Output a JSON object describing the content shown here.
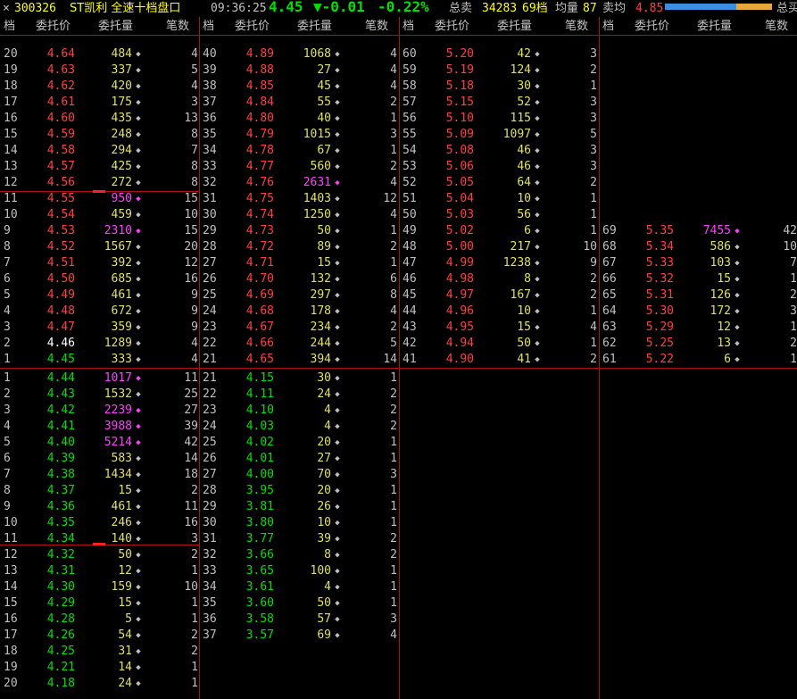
{
  "header": {
    "close": "×",
    "code": "300326",
    "name": "ST凯利 全速十档盘口",
    "time": "09:36:25",
    "price": "4.45",
    "change": "▼-0.01",
    "pct": "-0.22%",
    "total_sell_label": "总卖",
    "total_sell": "34283",
    "levels": "69档",
    "avg_label": "均量",
    "avg_val": "87",
    "sell_avg_label": "卖均",
    "sell_avg": "4.85",
    "total_label_right": "总买"
  },
  "colors": {
    "bg": "#000000",
    "grid": "#b01010",
    "sell": "#ff4040",
    "buy": "#00e000",
    "vol": "#e0e060",
    "highlight": "#ff40ff"
  },
  "columns": [
    "档",
    "委托价",
    "委托量",
    "笔数"
  ],
  "sell_cols": [
    {
      "rows": [
        {
          "i": "20",
          "p": "4.64",
          "v": "484",
          "d": "◆",
          "c": "4"
        },
        {
          "i": "19",
          "p": "4.63",
          "v": "337",
          "d": "◆",
          "c": "5"
        },
        {
          "i": "18",
          "p": "4.62",
          "v": "420",
          "d": "◆",
          "c": "4"
        },
        {
          "i": "17",
          "p": "4.61",
          "v": "175",
          "d": "◆",
          "c": "3"
        },
        {
          "i": "16",
          "p": "4.60",
          "v": "435",
          "d": "◆",
          "c": "13"
        },
        {
          "i": "15",
          "p": "4.59",
          "v": "248",
          "d": "◆",
          "c": "8"
        },
        {
          "i": "14",
          "p": "4.58",
          "v": "294",
          "d": "◆",
          "c": "7"
        },
        {
          "i": "13",
          "p": "4.57",
          "v": "425",
          "d": "◆",
          "c": "8"
        },
        {
          "i": "12",
          "p": "4.56",
          "v": "272",
          "d": "◆",
          "c": "8"
        },
        {
          "i": "11",
          "p": "4.55",
          "v": "950",
          "d": "◆",
          "c": "15",
          "m": true
        },
        {
          "i": "10",
          "p": "4.54",
          "v": "459",
          "d": "◆",
          "c": "10"
        },
        {
          "i": "9",
          "p": "4.53",
          "v": "2310",
          "d": "◆",
          "c": "15",
          "m": true
        },
        {
          "i": "8",
          "p": "4.52",
          "v": "1567",
          "d": "◆",
          "c": "20"
        },
        {
          "i": "7",
          "p": "4.51",
          "v": "392",
          "d": "◆",
          "c": "12"
        },
        {
          "i": "6",
          "p": "4.50",
          "v": "685",
          "d": "◆",
          "c": "16"
        },
        {
          "i": "5",
          "p": "4.49",
          "v": "461",
          "d": "◆",
          "c": "9"
        },
        {
          "i": "4",
          "p": "4.48",
          "v": "672",
          "d": "◆",
          "c": "9"
        },
        {
          "i": "3",
          "p": "4.47",
          "v": "359",
          "d": "◆",
          "c": "9"
        },
        {
          "i": "2",
          "p": "4.46",
          "v": "1289",
          "d": "◆",
          "c": "4",
          "w": true
        },
        {
          "i": "1",
          "p": "4.45",
          "v": "333",
          "d": "◆",
          "c": "4",
          "g": true
        }
      ]
    },
    {
      "rows": [
        {
          "i": "40",
          "p": "4.89",
          "v": "1068",
          "d": "◆",
          "c": "4"
        },
        {
          "i": "39",
          "p": "4.88",
          "v": "27",
          "d": "◆",
          "c": "4"
        },
        {
          "i": "38",
          "p": "4.85",
          "v": "45",
          "d": "◆",
          "c": "4"
        },
        {
          "i": "37",
          "p": "4.84",
          "v": "55",
          "d": "◆",
          "c": "2"
        },
        {
          "i": "36",
          "p": "4.80",
          "v": "40",
          "d": "◆",
          "c": "1"
        },
        {
          "i": "35",
          "p": "4.79",
          "v": "1015",
          "d": "◆",
          "c": "3"
        },
        {
          "i": "34",
          "p": "4.78",
          "v": "67",
          "d": "◆",
          "c": "1"
        },
        {
          "i": "33",
          "p": "4.77",
          "v": "560",
          "d": "◆",
          "c": "2"
        },
        {
          "i": "32",
          "p": "4.76",
          "v": "2631",
          "d": "◆",
          "c": "4",
          "m": true
        },
        {
          "i": "31",
          "p": "4.75",
          "v": "1403",
          "d": "◆",
          "c": "12"
        },
        {
          "i": "30",
          "p": "4.74",
          "v": "1250",
          "d": "◆",
          "c": "4"
        },
        {
          "i": "29",
          "p": "4.73",
          "v": "50",
          "d": "◆",
          "c": "1"
        },
        {
          "i": "28",
          "p": "4.72",
          "v": "89",
          "d": "◆",
          "c": "2"
        },
        {
          "i": "27",
          "p": "4.71",
          "v": "15",
          "d": "◆",
          "c": "1"
        },
        {
          "i": "26",
          "p": "4.70",
          "v": "132",
          "d": "◆",
          "c": "6"
        },
        {
          "i": "25",
          "p": "4.69",
          "v": "297",
          "d": "◆",
          "c": "8"
        },
        {
          "i": "24",
          "p": "4.68",
          "v": "178",
          "d": "◆",
          "c": "4"
        },
        {
          "i": "23",
          "p": "4.67",
          "v": "234",
          "d": "◆",
          "c": "2"
        },
        {
          "i": "22",
          "p": "4.66",
          "v": "244",
          "d": "◆",
          "c": "5"
        },
        {
          "i": "21",
          "p": "4.65",
          "v": "394",
          "d": "◆",
          "c": "14"
        }
      ]
    },
    {
      "rows": [
        {
          "i": "60",
          "p": "5.20",
          "v": "42",
          "d": "◆",
          "c": "3"
        },
        {
          "i": "59",
          "p": "5.19",
          "v": "124",
          "d": "◆",
          "c": "2"
        },
        {
          "i": "58",
          "p": "5.18",
          "v": "30",
          "d": "◆",
          "c": "1"
        },
        {
          "i": "57",
          "p": "5.15",
          "v": "52",
          "d": "◆",
          "c": "3"
        },
        {
          "i": "56",
          "p": "5.10",
          "v": "115",
          "d": "◆",
          "c": "3"
        },
        {
          "i": "55",
          "p": "5.09",
          "v": "1097",
          "d": "◆",
          "c": "5"
        },
        {
          "i": "54",
          "p": "5.08",
          "v": "46",
          "d": "◆",
          "c": "3"
        },
        {
          "i": "53",
          "p": "5.06",
          "v": "46",
          "d": "◆",
          "c": "3"
        },
        {
          "i": "52",
          "p": "5.05",
          "v": "64",
          "d": "◆",
          "c": "2"
        },
        {
          "i": "51",
          "p": "5.04",
          "v": "10",
          "d": "◆",
          "c": "1"
        },
        {
          "i": "50",
          "p": "5.03",
          "v": "56",
          "d": "◆",
          "c": "1"
        },
        {
          "i": "49",
          "p": "5.02",
          "v": "6",
          "d": "◆",
          "c": "1"
        },
        {
          "i": "48",
          "p": "5.00",
          "v": "217",
          "d": "◆",
          "c": "10"
        },
        {
          "i": "47",
          "p": "4.99",
          "v": "1238",
          "d": "◆",
          "c": "9"
        },
        {
          "i": "46",
          "p": "4.98",
          "v": "8",
          "d": "◆",
          "c": "2"
        },
        {
          "i": "45",
          "p": "4.97",
          "v": "167",
          "d": "◆",
          "c": "2"
        },
        {
          "i": "44",
          "p": "4.96",
          "v": "10",
          "d": "◆",
          "c": "1"
        },
        {
          "i": "43",
          "p": "4.95",
          "v": "15",
          "d": "◆",
          "c": "4"
        },
        {
          "i": "42",
          "p": "4.94",
          "v": "50",
          "d": "◆",
          "c": "1"
        },
        {
          "i": "41",
          "p": "4.90",
          "v": "41",
          "d": "◆",
          "c": "2"
        }
      ]
    },
    {
      "start": 11,
      "rows": [
        {
          "i": "69",
          "p": "5.35",
          "v": "7455",
          "d": "◆",
          "c": "42",
          "m": true
        },
        {
          "i": "68",
          "p": "5.34",
          "v": "586",
          "d": "◆",
          "c": "10"
        },
        {
          "i": "67",
          "p": "5.33",
          "v": "103",
          "d": "◆",
          "c": "7"
        },
        {
          "i": "66",
          "p": "5.32",
          "v": "15",
          "d": "◆",
          "c": "1"
        },
        {
          "i": "65",
          "p": "5.31",
          "v": "126",
          "d": "◆",
          "c": "2"
        },
        {
          "i": "64",
          "p": "5.30",
          "v": "172",
          "d": "◆",
          "c": "3"
        },
        {
          "i": "63",
          "p": "5.29",
          "v": "12",
          "d": "◆",
          "c": "1"
        },
        {
          "i": "62",
          "p": "5.25",
          "v": "13",
          "d": "◆",
          "c": "2"
        },
        {
          "i": "61",
          "p": "5.22",
          "v": "6",
          "d": "◆",
          "c": "1"
        }
      ]
    }
  ],
  "buy_cols": [
    {
      "rows": [
        {
          "i": "1",
          "p": "4.44",
          "v": "1017",
          "d": "◆",
          "c": "11",
          "m": true
        },
        {
          "i": "2",
          "p": "4.43",
          "v": "1532",
          "d": "◆",
          "c": "25"
        },
        {
          "i": "3",
          "p": "4.42",
          "v": "2239",
          "d": "◆",
          "c": "27",
          "m": true
        },
        {
          "i": "4",
          "p": "4.41",
          "v": "3988",
          "d": "◆",
          "c": "39",
          "m": true
        },
        {
          "i": "5",
          "p": "4.40",
          "v": "5214",
          "d": "◆",
          "c": "42",
          "m": true
        },
        {
          "i": "6",
          "p": "4.39",
          "v": "583",
          "d": "◆",
          "c": "14"
        },
        {
          "i": "7",
          "p": "4.38",
          "v": "1434",
          "d": "◆",
          "c": "18"
        },
        {
          "i": "8",
          "p": "4.37",
          "v": "15",
          "d": "◆",
          "c": "2"
        },
        {
          "i": "9",
          "p": "4.36",
          "v": "461",
          "d": "◆",
          "c": "11"
        },
        {
          "i": "10",
          "p": "4.35",
          "v": "246",
          "d": "◆",
          "c": "16"
        },
        {
          "i": "11",
          "p": "4.34",
          "v": "140",
          "d": "◆",
          "c": "3"
        },
        {
          "i": "12",
          "p": "4.32",
          "v": "50",
          "d": "◆",
          "c": "2"
        },
        {
          "i": "13",
          "p": "4.31",
          "v": "12",
          "d": "◆",
          "c": "1"
        },
        {
          "i": "14",
          "p": "4.30",
          "v": "159",
          "d": "◆",
          "c": "10"
        },
        {
          "i": "15",
          "p": "4.29",
          "v": "15",
          "d": "◆",
          "c": "1"
        },
        {
          "i": "16",
          "p": "4.28",
          "v": "5",
          "d": "◆",
          "c": "1"
        },
        {
          "i": "17",
          "p": "4.26",
          "v": "54",
          "d": "◆",
          "c": "2"
        },
        {
          "i": "18",
          "p": "4.25",
          "v": "31",
          "d": "◆",
          "c": "2"
        },
        {
          "i": "19",
          "p": "4.21",
          "v": "14",
          "d": "◆",
          "c": "1"
        },
        {
          "i": "20",
          "p": "4.18",
          "v": "24",
          "d": "◆",
          "c": "1"
        }
      ]
    },
    {
      "rows": [
        {
          "i": "21",
          "p": "4.15",
          "v": "30",
          "d": "◆",
          "c": "1"
        },
        {
          "i": "22",
          "p": "4.11",
          "v": "24",
          "d": "◆",
          "c": "2"
        },
        {
          "i": "23",
          "p": "4.10",
          "v": "4",
          "d": "◆",
          "c": "2"
        },
        {
          "i": "24",
          "p": "4.03",
          "v": "4",
          "d": "◆",
          "c": "2"
        },
        {
          "i": "25",
          "p": "4.02",
          "v": "20",
          "d": "◆",
          "c": "1"
        },
        {
          "i": "26",
          "p": "4.01",
          "v": "27",
          "d": "◆",
          "c": "1"
        },
        {
          "i": "27",
          "p": "4.00",
          "v": "70",
          "d": "◆",
          "c": "3"
        },
        {
          "i": "28",
          "p": "3.95",
          "v": "20",
          "d": "◆",
          "c": "1"
        },
        {
          "i": "29",
          "p": "3.81",
          "v": "26",
          "d": "◆",
          "c": "1"
        },
        {
          "i": "30",
          "p": "3.80",
          "v": "10",
          "d": "◆",
          "c": "1"
        },
        {
          "i": "31",
          "p": "3.77",
          "v": "39",
          "d": "◆",
          "c": "2"
        },
        {
          "i": "32",
          "p": "3.66",
          "v": "8",
          "d": "◆",
          "c": "2"
        },
        {
          "i": "33",
          "p": "3.65",
          "v": "100",
          "d": "◆",
          "c": "1"
        },
        {
          "i": "34",
          "p": "3.61",
          "v": "4",
          "d": "◆",
          "c": "1"
        },
        {
          "i": "35",
          "p": "3.60",
          "v": "50",
          "d": "◆",
          "c": "1"
        },
        {
          "i": "36",
          "p": "3.58",
          "v": "57",
          "d": "◆",
          "c": "3"
        },
        {
          "i": "37",
          "p": "3.57",
          "v": "69",
          "d": "◆",
          "c": "4"
        }
      ]
    }
  ]
}
